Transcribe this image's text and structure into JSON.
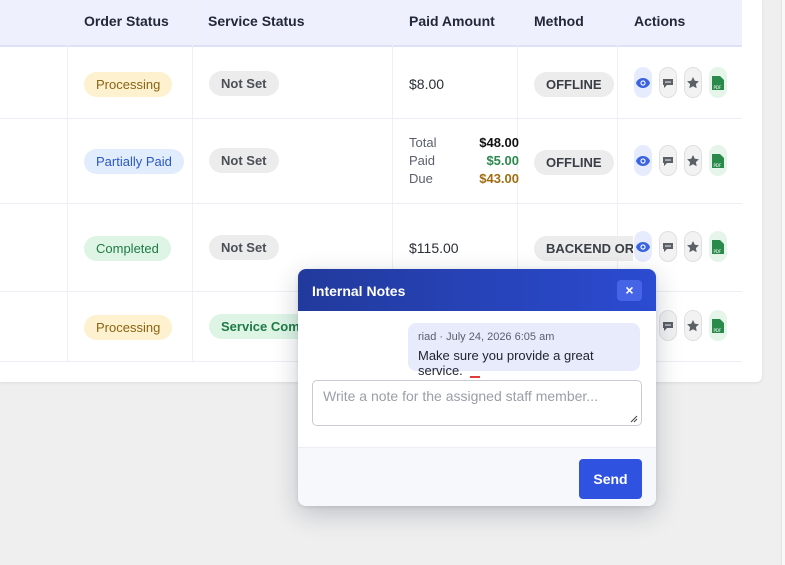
{
  "table": {
    "columns": [
      "Order Status",
      "Service Status",
      "Paid Amount",
      "Method",
      "Actions"
    ],
    "rows": [
      {
        "order_status": "Processing",
        "service_status": "Not Set",
        "paid_amount": "$8.00",
        "method": "OFFLINE"
      },
      {
        "order_status": "Partially Paid",
        "service_status": "Not Set",
        "breakdown": {
          "total_label": "Total",
          "total": "$48.00",
          "paid_label": "Paid",
          "paid": "$5.00",
          "due_label": "Due",
          "due": "$43.00"
        },
        "method": "OFFLINE"
      },
      {
        "order_status": "Completed",
        "service_status": "Not Set",
        "paid_amount": "$115.00",
        "method": "BACKEND ORDER"
      },
      {
        "order_status": "Processing",
        "service_status": "Service Completed"
      }
    ]
  },
  "actions": {
    "icons": [
      "eye-icon",
      "comment-icon",
      "star-icon",
      "pdf-icon"
    ],
    "pdf_text": "PDF"
  },
  "modal": {
    "title": "Internal Notes",
    "close_label": "×",
    "note": {
      "meta": "riad · July 24, 2026 6:05 am",
      "text": "Make sure you provide a great service."
    },
    "input_placeholder": "Write a note for the assigned staff member...",
    "send_label": "Send"
  },
  "colors": {
    "accent": "#2f52e0",
    "header_gradient_start": "#223a9c",
    "header_gradient_end": "#2b4bd1",
    "view_icon": "#3b63e0",
    "pdf_icon": "#2a8a4c"
  }
}
